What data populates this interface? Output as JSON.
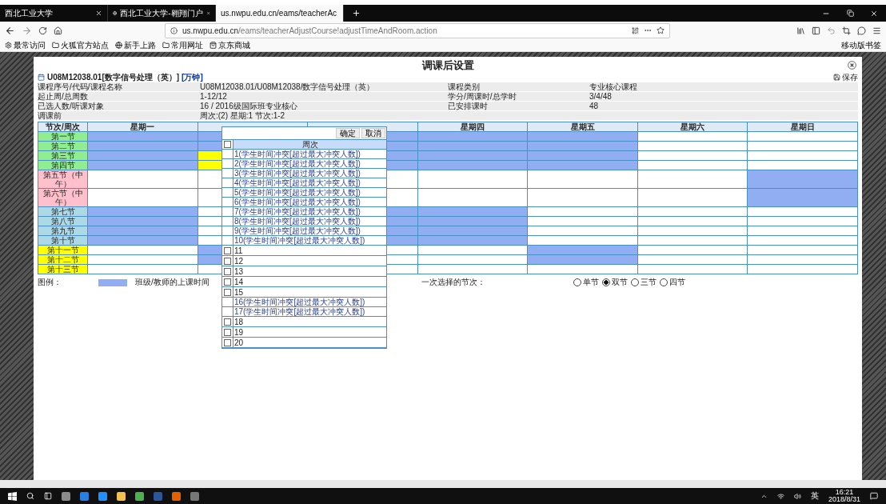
{
  "browser": {
    "tabs": [
      {
        "label": "西北工业大学",
        "selected": false,
        "favicon": false
      },
      {
        "label": "西北工业大学-翱翔门户",
        "selected": false,
        "favicon": true
      },
      {
        "label": "us.nwpu.edu.cn/eams/teacherAc",
        "selected": true,
        "favicon": false
      }
    ],
    "url_host": "us.nwpu.edu.cn",
    "url_path": "/eams/teacherAdjustCourse!adjustTimeAndRoom.action",
    "bookmarks": [
      {
        "label": "最常访问",
        "kind": "gear"
      },
      {
        "label": "火狐官方站点",
        "kind": "folder"
      },
      {
        "label": "新手上路",
        "kind": "globe"
      },
      {
        "label": "常用网址",
        "kind": "folder"
      },
      {
        "label": "京东商城",
        "kind": "shop"
      }
    ],
    "mobile_bookmarks": "移动版书签"
  },
  "dialog": {
    "title": "调课后设置",
    "course": "U08M12038.01[数字信号处理（英）]",
    "teacher": "[万钟]",
    "save": "保存",
    "info": [
      [
        "课程序号/代码/课程名称",
        "U08M12038.01/U08M12038/数字信号处理（英）",
        "课程类别",
        "专业核心课程"
      ],
      [
        "起止周/总周数",
        "1-12/12",
        "学分/周课时/总学时",
        "3/4/48"
      ],
      [
        "已选人数/听课对象",
        "16 / 2016级国际班专业核心",
        "已安排课时",
        "48"
      ],
      [
        "调课前",
        "周次:(2) 星期:1 节次:1-2"
      ]
    ]
  },
  "timetable": {
    "corner": "节次/周次",
    "days": [
      "星期一",
      "星期四",
      "星期五",
      "星期六",
      "星期日"
    ],
    "sections": [
      {
        "label": "第一节",
        "color": "#90ee90",
        "busy": [
          true,
          true,
          true,
          true,
          true,
          false,
          false
        ],
        "highlighted": [
          false,
          false,
          false,
          false,
          false,
          false,
          false
        ]
      },
      {
        "label": "第二节",
        "color": "#90ee90",
        "busy": [
          true,
          true,
          true,
          true,
          true,
          false,
          false
        ],
        "highlighted": [
          false,
          false,
          false,
          false,
          false,
          false,
          false
        ]
      },
      {
        "label": "第三节",
        "color": "#90ee90",
        "busy": [
          true,
          false,
          true,
          true,
          true,
          false,
          false
        ],
        "highlighted": [
          false,
          true,
          false,
          false,
          false,
          false,
          false
        ]
      },
      {
        "label": "第四节",
        "color": "#90ee90",
        "busy": [
          true,
          false,
          true,
          true,
          true,
          false,
          false
        ],
        "highlighted": [
          false,
          true,
          false,
          false,
          false,
          false,
          false
        ]
      },
      {
        "label": "第五节（中午）",
        "color": "#ffc0cb",
        "busy": [
          false,
          false,
          false,
          false,
          false,
          false,
          true
        ],
        "highlighted": [
          false,
          false,
          false,
          false,
          false,
          false,
          false
        ]
      },
      {
        "label": "第六节（中午）",
        "color": "#ffc0cb",
        "busy": [
          false,
          false,
          false,
          false,
          false,
          false,
          true
        ],
        "highlighted": [
          false,
          false,
          false,
          false,
          false,
          false,
          false
        ]
      },
      {
        "label": "第七节",
        "color": "#add8e6",
        "busy": [
          true,
          false,
          true,
          true,
          false,
          false,
          false
        ],
        "highlighted": [
          false,
          false,
          false,
          false,
          false,
          false,
          false
        ]
      },
      {
        "label": "第八节",
        "color": "#add8e6",
        "busy": [
          true,
          false,
          true,
          true,
          false,
          false,
          false
        ],
        "highlighted": [
          false,
          false,
          false,
          false,
          false,
          false,
          false
        ]
      },
      {
        "label": "第九节",
        "color": "#add8e6",
        "busy": [
          true,
          false,
          true,
          true,
          false,
          false,
          false
        ],
        "highlighted": [
          false,
          false,
          false,
          false,
          false,
          false,
          false
        ]
      },
      {
        "label": "第十节",
        "color": "#add8e6",
        "busy": [
          true,
          false,
          true,
          true,
          false,
          false,
          false
        ],
        "highlighted": [
          false,
          false,
          false,
          false,
          false,
          false,
          false
        ]
      },
      {
        "label": "第十一节",
        "color": "#ffff00",
        "busy": [
          false,
          true,
          false,
          false,
          true,
          false,
          false
        ],
        "highlighted": [
          false,
          false,
          false,
          false,
          false,
          false,
          false
        ]
      },
      {
        "label": "第十二节",
        "color": "#ffff00",
        "busy": [
          false,
          true,
          false,
          false,
          true,
          false,
          false
        ],
        "highlighted": [
          false,
          false,
          false,
          false,
          false,
          false,
          false
        ]
      },
      {
        "label": "第十三节",
        "color": "#ffff00",
        "busy": [
          false,
          false,
          false,
          false,
          false,
          false,
          false
        ],
        "highlighted": [
          false,
          false,
          false,
          false,
          false,
          false,
          false
        ]
      }
    ]
  },
  "legend": {
    "label": "图例：",
    "text": "班级/教师的上课时间"
  },
  "span_choice": {
    "label": "一次选择的节次：",
    "options": [
      {
        "label": "单节",
        "selected": false
      },
      {
        "label": "双节",
        "selected": true
      },
      {
        "label": "三节",
        "selected": false
      },
      {
        "label": "四节",
        "selected": false
      }
    ]
  },
  "week_popup": {
    "confirm": "确定",
    "cancel": "取消",
    "header": "周次",
    "all_checked": false,
    "weeks": [
      {
        "label": "1(学生时间冲突[超过最大冲突人数])",
        "kind": "conflict"
      },
      {
        "label": "2(学生时间冲突[超过最大冲突人数])",
        "kind": "conflict"
      },
      {
        "label": "3(学生时间冲突[超过最大冲突人数])",
        "kind": "conflict"
      },
      {
        "label": "4(学生时间冲突[超过最大冲突人数])",
        "kind": "conflict"
      },
      {
        "label": "5(学生时间冲突[超过最大冲突人数])",
        "kind": "conflict"
      },
      {
        "label": "6(学生时间冲突[超过最大冲突人数])",
        "kind": "conflict"
      },
      {
        "label": "7(学生时间冲突[超过最大冲突人数])",
        "kind": "conflict"
      },
      {
        "label": "8(学生时间冲突[超过最大冲突人数])",
        "kind": "conflict"
      },
      {
        "label": "9(学生时间冲突[超过最大冲突人数])",
        "kind": "conflict"
      },
      {
        "label": "10(学生时间冲突[超过最大冲突人数])",
        "kind": "conflict"
      },
      {
        "label": "11",
        "kind": "option",
        "checked": false
      },
      {
        "label": "12",
        "kind": "option",
        "checked": false
      },
      {
        "label": "13",
        "kind": "option",
        "checked": false
      },
      {
        "label": "14",
        "kind": "option",
        "checked": false
      },
      {
        "label": "15",
        "kind": "option",
        "checked": false
      },
      {
        "label": "16(学生时间冲突[超过最大冲突人数])",
        "kind": "conflict"
      },
      {
        "label": "17(学生时间冲突[超过最大冲突人数])",
        "kind": "conflict"
      },
      {
        "label": "18",
        "kind": "option",
        "checked": false
      },
      {
        "label": "19",
        "kind": "option",
        "checked": false
      },
      {
        "label": "20",
        "kind": "option",
        "checked": false
      }
    ]
  },
  "taskbar": {
    "ime": "英",
    "time": "16:21",
    "date": "2018/8/31"
  }
}
